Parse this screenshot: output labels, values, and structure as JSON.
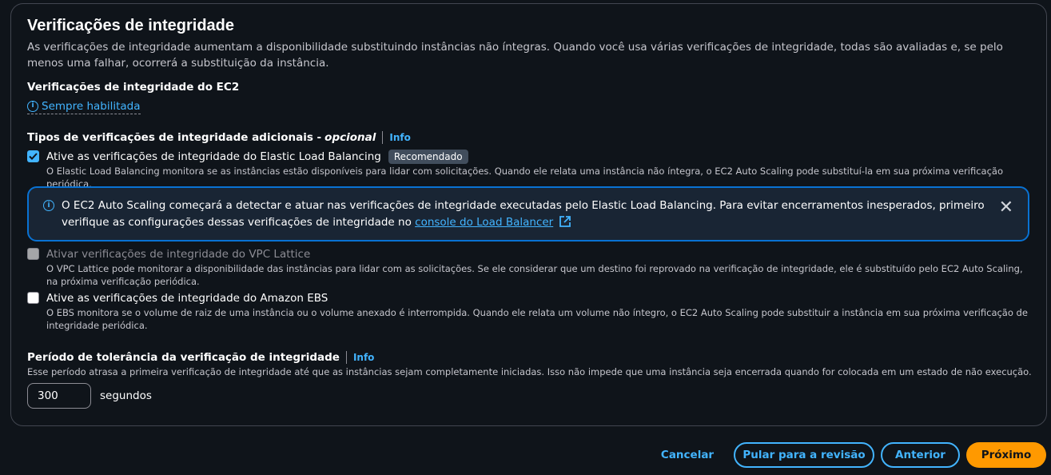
{
  "section": {
    "title": "Verificações de integridade",
    "description": "As verificações de integridade aumentam a disponibilidade substituindo instâncias não íntegras. Quando você usa várias verificações de integridade, todas são avaliadas e, se pelo menos uma falhar, ocorrerá a substituição da instância."
  },
  "ec2": {
    "label": "Verificações de integridade do EC2",
    "status": "Sempre habilitada"
  },
  "additional": {
    "label": "Tipos de verificações de integridade adicionais -",
    "optional": "opcional",
    "info": "Info",
    "elb": {
      "title": "Ative as verificações de integridade do Elastic Load Balancing",
      "badge": "Recomendado",
      "description": "O Elastic Load Balancing monitora se as instâncias estão disponíveis para lidar com solicitações. Quando ele relata uma instância não íntegra, o EC2 Auto Scaling pode substituí-la em sua próxima verificação periódica."
    },
    "alert": {
      "text": "O EC2 Auto Scaling começará a detectar e atuar nas verificações de integridade executadas pelo Elastic Load Balancing. Para evitar encerramentos inesperados, primeiro verifique as configurações dessas verificações de integridade no",
      "link": "console do Load Balancer"
    },
    "vpc": {
      "title": "Ativar verificações de integridade do VPC Lattice",
      "description": "O VPC Lattice pode monitorar a disponibilidade das instâncias para lidar com as solicitações. Se ele considerar que um destino foi reprovado na verificação de integridade, ele é substituído pelo EC2 Auto Scaling, na próxima verificação periódica."
    },
    "ebs": {
      "title": "Ative as verificações de integridade do Amazon EBS",
      "description": "O EBS monitora se o volume de raiz de uma instância ou o volume anexado é interrompida. Quando ele relata um volume não íntegro, o EC2 Auto Scaling pode substituir a instância em sua próxima verificação de integridade periódica."
    }
  },
  "grace": {
    "label": "Período de tolerância da verificação de integridade",
    "info": "Info",
    "description": "Esse período atrasa a primeira verificação de integridade até que as instâncias sejam completamente iniciadas. Isso não impede que uma instância seja encerrada quando for colocada em um estado de não execução.",
    "value": "300",
    "unit": "segundos"
  },
  "footer": {
    "cancel": "Cancelar",
    "skip": "Pular para a revisão",
    "previous": "Anterior",
    "next": "Próximo"
  },
  "colors": {
    "accent": "#42b4ff",
    "primary": "#ff9900",
    "alert_border": "#0972d3"
  }
}
